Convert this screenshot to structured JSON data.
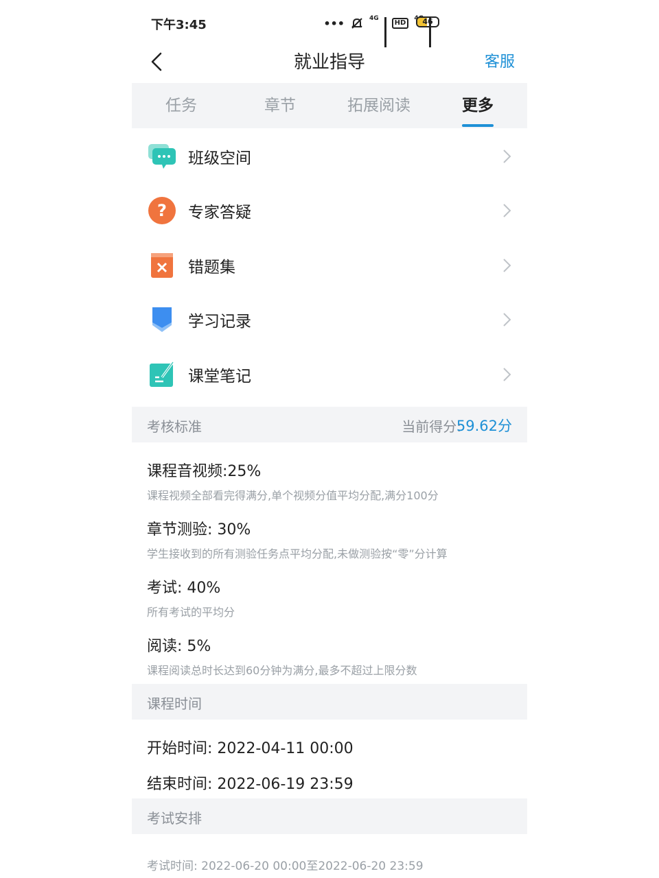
{
  "status_bar": {
    "time": "下午3:45",
    "net1": "4G",
    "net2": "4G",
    "hd": "HD",
    "battery": "46",
    "battery_level": 0.46
  },
  "header": {
    "title": "就业指导",
    "service": "客服",
    "back_icon": "chevron-left-icon"
  },
  "tabs": [
    {
      "label": "任务",
      "active": false
    },
    {
      "label": "章节",
      "active": false
    },
    {
      "label": "拓展阅读",
      "active": false
    },
    {
      "label": "更多",
      "active": true
    }
  ],
  "menu": [
    {
      "label": "班级空间",
      "icon": "chat-bubble-icon",
      "color": "#2ec4b6"
    },
    {
      "label": "专家答疑",
      "icon": "question-circle-icon",
      "color": "#f0743e"
    },
    {
      "label": "错题集",
      "icon": "wrong-book-icon",
      "color": "#f0743e"
    },
    {
      "label": "学习记录",
      "icon": "record-bookmark-icon",
      "color": "#3d8ef0"
    },
    {
      "label": "课堂笔记",
      "icon": "note-pen-icon",
      "color": "#2ec4b6"
    }
  ],
  "assessment": {
    "title": "考核标准",
    "score_label": "当前得分:",
    "score_value": "59.62分",
    "rules": [
      {
        "title": "课程音视频:25%",
        "desc": "课程视频全部看完得满分,单个视频分值平均分配,满分100分"
      },
      {
        "title": "章节测验: 30%",
        "desc": "学生接收到的所有测验任务点平均分配,未做测验按“零”分计算"
      },
      {
        "title": "考试: 40%",
        "desc": "所有考试的平均分"
      },
      {
        "title": "阅读: 5%",
        "desc": "课程阅读总时长达到60分钟为满分,最多不超过上限分数"
      }
    ]
  },
  "course_time": {
    "title": "课程时间",
    "start": "开始时间: 2022-04-11 00:00",
    "end": "结束时间: 2022-06-19 23:59"
  },
  "exam": {
    "title": "考试安排",
    "time_label": "考试时间:",
    "time_value": "2022-06-20 00:00至2022-06-20 23:59"
  },
  "colors": {
    "accent": "#1e90d6",
    "section_bg": "#f3f4f6",
    "muted_text": "#9aa0a6"
  }
}
